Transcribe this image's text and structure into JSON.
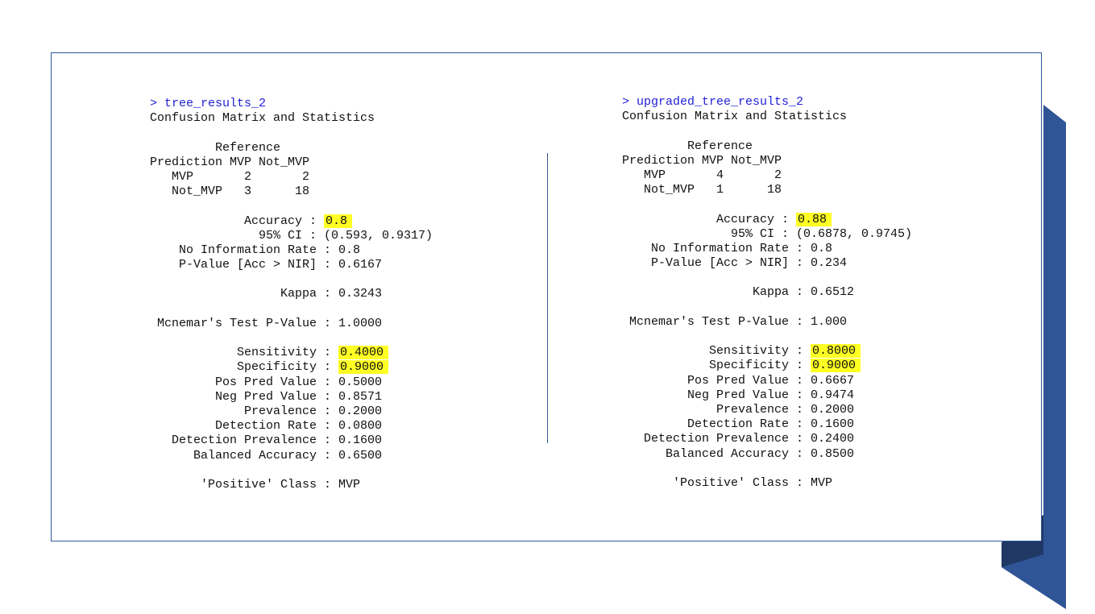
{
  "left_output": {
    "command": "> tree_results_2",
    "title": "Confusion Matrix and Statistics",
    "matrix": {
      "ref_header": "         Reference",
      "col_header": "Prediction MVP Not_MVP",
      "row_mvp": "   MVP       2       2",
      "row_not_mvp": "   Not_MVP   3      18"
    },
    "accuracy_label": "             Accuracy : ",
    "accuracy_value": "0.8",
    "ci": "               95% CI : (0.593, 0.9317)",
    "nir": "    No Information Rate : 0.8",
    "pvalue": "    P-Value [Acc > NIR] : 0.6167",
    "kappa": "                  Kappa : 0.3243",
    "mcnemar": " Mcnemar's Test P-Value : 1.0000",
    "sensitivity_label": "            Sensitivity : ",
    "sensitivity_value": "0.4000",
    "specificity_label": "            Specificity : ",
    "specificity_value": "0.9000",
    "pos_pred": "         Pos Pred Value : 0.5000",
    "neg_pred": "         Neg Pred Value : 0.8571",
    "prevalence": "             Prevalence : 0.2000",
    "detection_rate": "         Detection Rate : 0.0800",
    "detection_prev": "   Detection Prevalence : 0.1600",
    "balanced": "      Balanced Accuracy : 0.6500",
    "positive_class": "       'Positive' Class : MVP"
  },
  "right_output": {
    "command": "> upgraded_tree_results_2",
    "title": "Confusion Matrix and Statistics",
    "matrix": {
      "ref_header": "         Reference",
      "col_header": "Prediction MVP Not_MVP",
      "row_mvp": "   MVP       4       2",
      "row_not_mvp": "   Not_MVP   1      18"
    },
    "accuracy_label": "             Accuracy : ",
    "accuracy_value": "0.88",
    "ci": "               95% CI : (0.6878, 0.9745)",
    "nir": "    No Information Rate : 0.8",
    "pvalue": "    P-Value [Acc > NIR] : 0.234",
    "kappa": "                  Kappa : 0.6512",
    "mcnemar": " Mcnemar's Test P-Value : 1.000",
    "sensitivity_label": "            Sensitivity : ",
    "sensitivity_value": "0.8000",
    "specificity_label": "            Specificity : ",
    "specificity_value": "0.9000",
    "pos_pred": "         Pos Pred Value : 0.6667",
    "neg_pred": "         Neg Pred Value : 0.9474",
    "prevalence": "             Prevalence : 0.2000",
    "detection_rate": "         Detection Rate : 0.1600",
    "detection_prev": "   Detection Prevalence : 0.2400",
    "balanced": "      Balanced Accuracy : 0.8500",
    "positive_class": "       'Positive' Class : MVP"
  },
  "colors": {
    "accent": "#2f5597",
    "accent_dark": "#203864",
    "highlight": "#ffff24",
    "command": "#1f1fd6"
  }
}
